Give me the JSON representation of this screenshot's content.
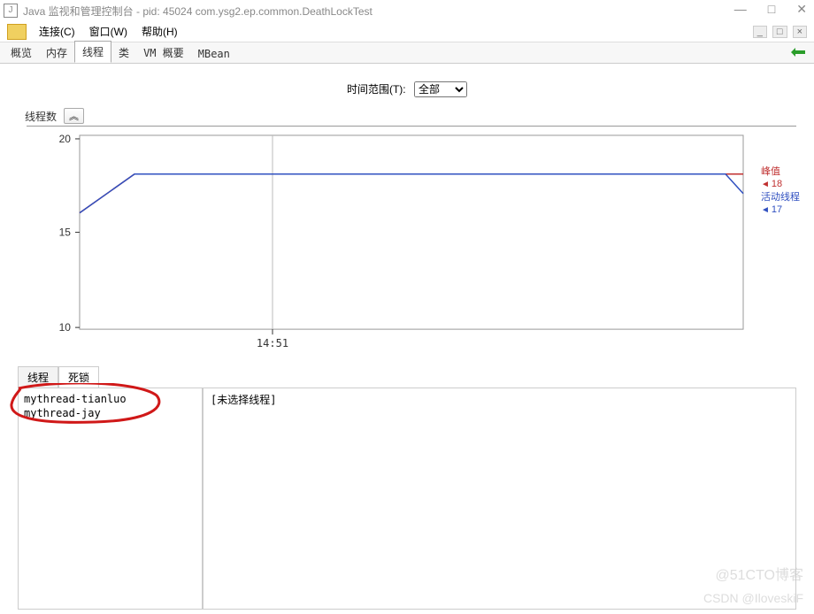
{
  "window": {
    "title": "Java 监视和管理控制台 - pid: 45024 com.ysg2.ep.common.DeathLockTest"
  },
  "menubar": {
    "connect": "连接(C)",
    "window": "窗口(W)",
    "help": "帮助(H)"
  },
  "tabs": {
    "overview": "概览",
    "memory": "内存",
    "threads": "线程",
    "classes": "类",
    "vm_summary": "VM 概要",
    "mbean": "MBean"
  },
  "time_range": {
    "label": "时间范围(T):",
    "value": "全部"
  },
  "chart_header": {
    "label": "线程数",
    "toggle_icon": "︽"
  },
  "chart_data": {
    "type": "line",
    "ylabel": "",
    "xlabel": "",
    "ylim": [
      10,
      20
    ],
    "yticks": [
      10,
      15,
      20
    ],
    "xticks": [
      "14:51"
    ],
    "series": [
      {
        "name": "峰值",
        "color": "#c03030",
        "values_label": "18",
        "points": [
          [
            0,
            16
          ],
          [
            0.08,
            18
          ],
          [
            0.92,
            18
          ],
          [
            0.935,
            18
          ]
        ]
      },
      {
        "name": "活动线程",
        "color": "#3050c0",
        "values_label": "17",
        "points": [
          [
            0,
            16
          ],
          [
            0.08,
            18
          ],
          [
            0.92,
            18
          ],
          [
            0.935,
            17
          ]
        ]
      }
    ]
  },
  "legend": {
    "peak_label": "峰值",
    "peak_value": "18",
    "live_label": "活动线程",
    "live_value": "17"
  },
  "bottom_tabs": {
    "threads": "线程",
    "deadlock": "死锁"
  },
  "thread_list": {
    "items": [
      "mythread-tianluo",
      "mythread-jay"
    ]
  },
  "detail": {
    "placeholder": "[未选择线程]"
  },
  "watermark": {
    "w1": "@51CTO博客",
    "w2": "CSDN @IloveskiF"
  }
}
